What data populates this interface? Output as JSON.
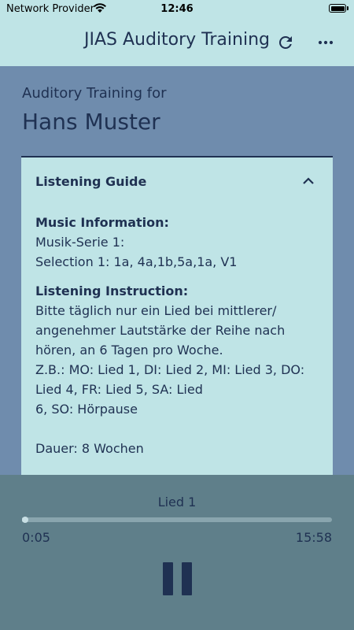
{
  "status_bar": {
    "carrier": "Network Provider",
    "time": "12:46"
  },
  "app_bar": {
    "title": "JIAS Auditory Training",
    "icons": [
      "refresh-icon",
      "more-icon"
    ]
  },
  "header": {
    "subtitle": "Auditory Training for",
    "patient_name": "Hans Muster"
  },
  "listening_guide": {
    "title": "Listening Guide",
    "expanded": true,
    "music_info_heading": "Music Information:",
    "music_info_lines": [
      "Musik-Serie 1:",
      "Selection 1: 1a, 4a,1b,5a,1a, V1"
    ],
    "instruction_heading": "Listening Instruction:",
    "instruction_lines": [
      "Bitte täglich nur ein Lied bei mittlerer/",
      "angenehmer Lautstärke der Reihe nach",
      "hören, an 6 Tagen pro Woche.",
      "Z.B.: MO: Lied 1, DI: Lied 2, MI: Lied 3, DO:",
      "Lied 4, FR: Lied 5, SA: Lied",
      "6, SO: Hörpause"
    ],
    "duration": "Dauer: 8 Wochen"
  },
  "player": {
    "track": "Lied 1",
    "current_time": "0:05",
    "total_time": "15:58",
    "progress": 0.005,
    "state_icon": "pause-icon"
  },
  "colors": {
    "background": "#6f8cad",
    "header_bg": "#bfe4e6",
    "card_bg": "#bfe4e6",
    "player_bg": "#5f7f8a",
    "text_dark": "#1f3152"
  }
}
